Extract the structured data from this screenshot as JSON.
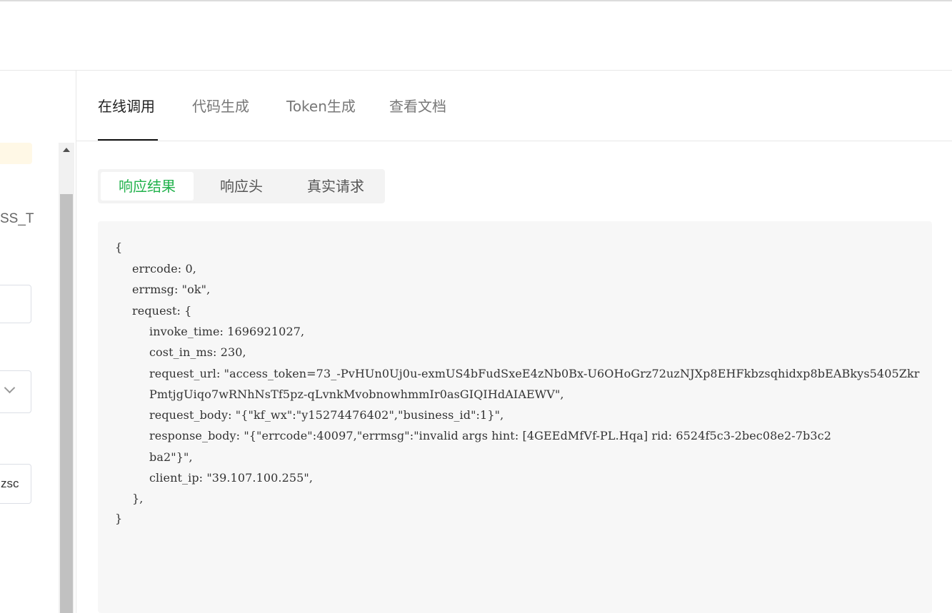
{
  "left_panel": {
    "cut_label": "SS_T",
    "field3_value": "zsc"
  },
  "tabs": [
    {
      "label": "在线调用",
      "active": true
    },
    {
      "label": "代码生成",
      "active": false
    },
    {
      "label": "Token生成",
      "active": false
    },
    {
      "label": "查看文档",
      "active": false
    }
  ],
  "subtabs": [
    {
      "label": "响应结果",
      "active": true
    },
    {
      "label": "响应头",
      "active": false
    },
    {
      "label": "真实请求",
      "active": false
    }
  ],
  "colors": {
    "accent_green": "#22b24c",
    "code_bg": "#f7f7f7"
  },
  "response_lines": [
    "{",
    "errcode: 0,",
    "errmsg: \"ok\",",
    "request: {",
    "invoke_time: 1696921027,",
    "cost_in_ms: 230,",
    "request_url: \"access_token=73_-PvHUn0Uj0u-exmUS4bFudSxeE4zNb0Bx-U6OHoGrz72uzNJXp8EHFkbzsqhidxp8bEABkys5405Zkr",
    "PmtjgUiqo7wRNhNsTf5pz-qLvnkMvobnowhmmIr0asGIQIHdAIAEWV\",",
    "request_body: \"{\"kf_wx\":\"y15274476402\",\"business_id\":1}\",",
    "response_body: \"{\"errcode\":40097,\"errmsg\":\"invalid args hint: [4GEEdMfVf-PL.Hqa] rid: 6524f5c3-2bec08e2-7b3c2",
    "ba2\"}\",",
    "client_ip: \"39.107.100.255\",",
    "},",
    "}"
  ]
}
